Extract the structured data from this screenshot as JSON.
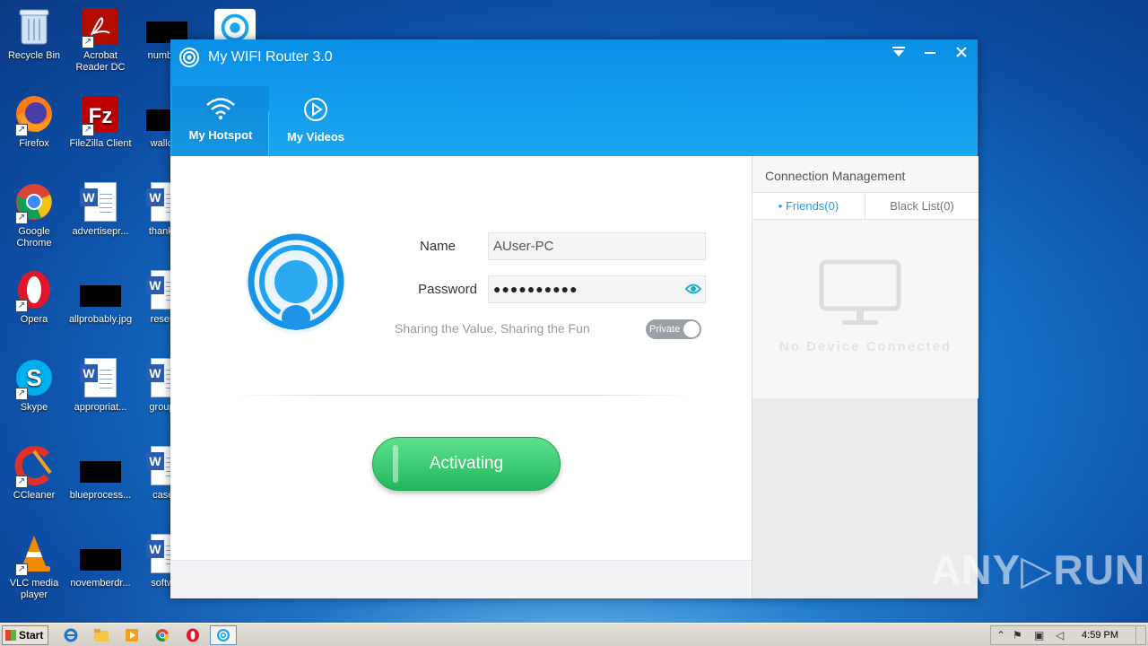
{
  "desktop": {
    "icons": [
      {
        "label": "Recycle Bin"
      },
      {
        "label": "Acrobat Reader DC"
      },
      {
        "label": "numbers"
      },
      {
        "label": "Firefox"
      },
      {
        "label": "FileZilla Client"
      },
      {
        "label": "wallcon"
      },
      {
        "label": "Google Chrome"
      },
      {
        "label": "advertisepr..."
      },
      {
        "label": "thanksw"
      },
      {
        "label": "Opera"
      },
      {
        "label": "allprobably.jpg"
      },
      {
        "label": "reserve"
      },
      {
        "label": "Skype"
      },
      {
        "label": "appropriat..."
      },
      {
        "label": "groupsc"
      },
      {
        "label": "CCleaner"
      },
      {
        "label": "blueprocess..."
      },
      {
        "label": "caselo"
      },
      {
        "label": "VLC media player"
      },
      {
        "label": "novemberdr..."
      },
      {
        "label": "softwar"
      }
    ]
  },
  "window": {
    "title": "My WIFI Router 3.0",
    "tabs": [
      {
        "label": "My Hotspot",
        "icon": "wifi-icon"
      },
      {
        "label": "My Videos",
        "icon": "play-icon"
      }
    ],
    "form": {
      "name_label": "Name",
      "name_value": "AUser-PC",
      "password_label": "Password",
      "password_value": "●●●●●●●●●●",
      "tagline": "Sharing the Value, Sharing the Fun",
      "toggle_label": "Private",
      "activate_label": "Activating"
    },
    "side": {
      "title": "Connection Management",
      "friends_tab": "• Friends(0)",
      "blacklist_tab": "Black List(0)",
      "empty_text": "No Device Connected"
    }
  },
  "taskbar": {
    "start_label": "Start",
    "clock": "4:59 PM"
  },
  "watermark": "ANY▷RUN",
  "colors": {
    "accent": "#1ba6f0",
    "activate": "#2ec766",
    "link": "#1aa0e8"
  }
}
